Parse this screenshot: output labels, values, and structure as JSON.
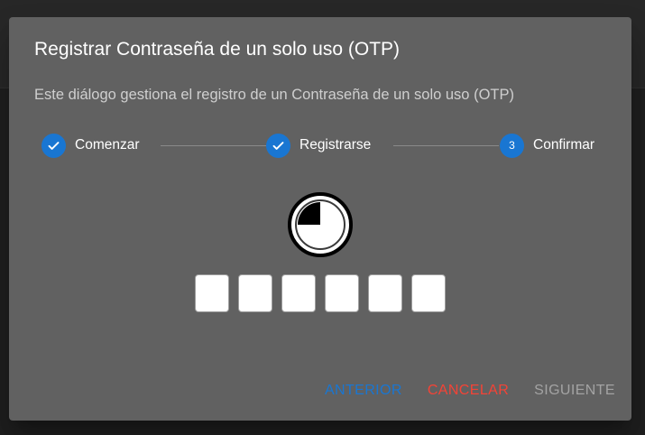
{
  "dialog": {
    "title": "Registrar Contraseña de un solo uso (OTP)",
    "description": "Este diálogo gestiona el registro de un Contraseña de un solo uso (OTP)"
  },
  "stepper": {
    "steps": [
      {
        "label": "Comenzar",
        "state": "completed",
        "icon": "check-icon"
      },
      {
        "label": "Registrarse",
        "state": "completed",
        "icon": "check-icon"
      },
      {
        "label": "Confirmar",
        "state": "active",
        "number": "3"
      }
    ]
  },
  "timer": {
    "elapsed_fraction": 0.25,
    "icon": "countdown-timer-icon"
  },
  "otp": {
    "digits": [
      "",
      "",
      "",
      "",
      "",
      ""
    ]
  },
  "actions": {
    "back_label": "ANTERIOR",
    "cancel_label": "CANCELAR",
    "next_label": "SIGUIENTE"
  },
  "colors": {
    "primary": "#1976d2",
    "danger": "#f44336",
    "disabled": "#9e9e9e",
    "dialog_bg": "#616161"
  }
}
